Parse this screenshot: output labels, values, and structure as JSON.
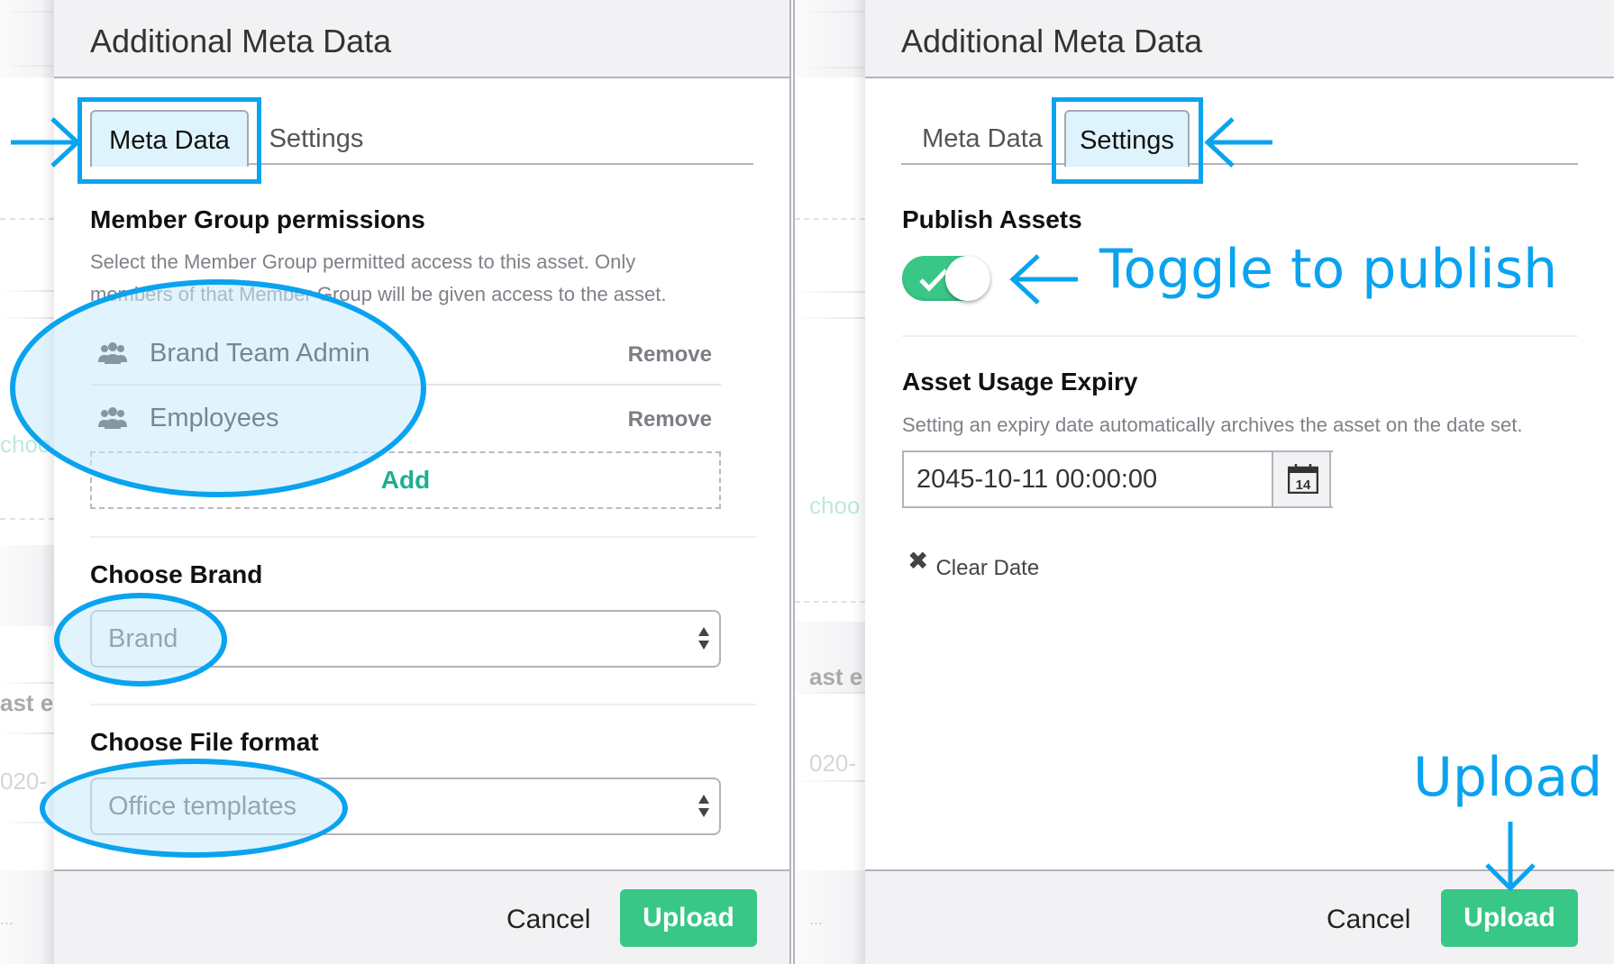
{
  "colors": {
    "annotation": "#0aa3ef",
    "primary_button": "#39c787",
    "add_link": "#1fae93",
    "header_bg": "#f2f2f4"
  },
  "left_panel": {
    "title": "Additional Meta Data",
    "tabs": [
      {
        "label": "Meta Data",
        "active": true
      },
      {
        "label": "Settings",
        "active": false
      }
    ],
    "member_groups": {
      "title": "Member Group permissions",
      "help_line1": "Select the Member Group permitted access to this asset. Only",
      "help_line2": "members of that Member Group will be given access to the asset.",
      "items": [
        {
          "icon": "users-icon",
          "name": "Brand Team Admin",
          "action": "Remove"
        },
        {
          "icon": "users-icon",
          "name": "Employees",
          "action": "Remove"
        }
      ],
      "add_label": "Add"
    },
    "brand": {
      "title": "Choose Brand",
      "selected": "Brand"
    },
    "file_format": {
      "title": "Choose File format",
      "selected": "Office templates"
    },
    "footer": {
      "cancel_label": "Cancel",
      "upload_label": "Upload"
    },
    "background_ghost": {
      "choose": "choo",
      "last_edited": "ast e",
      "date": "020-",
      "ellipsis": "..."
    }
  },
  "right_panel": {
    "title": "Additional Meta Data",
    "tabs": [
      {
        "label": "Meta Data",
        "active": false
      },
      {
        "label": "Settings",
        "active": true
      }
    ],
    "publish": {
      "title": "Publish Assets",
      "toggle_on": true
    },
    "expiry": {
      "title": "Asset Usage Expiry",
      "help": "Setting an expiry date automatically archives the asset on the date set.",
      "value": "2045-10-11 00:00:00",
      "calendar_day": "14",
      "clear_label": "Clear Date"
    },
    "footer": {
      "cancel_label": "Cancel",
      "upload_label": "Upload"
    },
    "background_ghost": {
      "choose": "choo",
      "last_edited": "ast e",
      "date": "020-",
      "ellipsis": "..."
    }
  },
  "annotations": {
    "toggle_hint": "Toggle to publish",
    "upload_hint": "Upload"
  }
}
